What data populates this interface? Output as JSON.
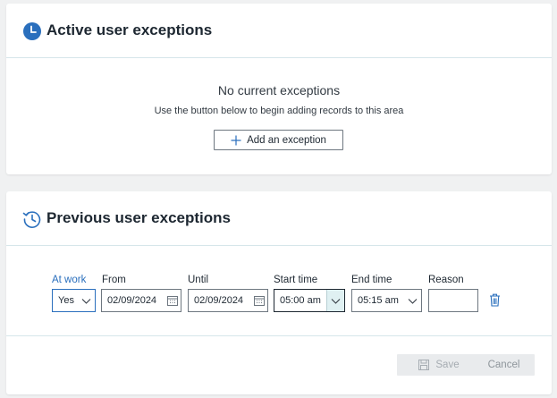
{
  "active": {
    "title": "Active user exceptions",
    "icon": "clock-icon",
    "empty_title": "No current exceptions",
    "empty_subtitle": "Use the button below to begin adding records to this area",
    "add_button_label": "Add an exception"
  },
  "previous": {
    "title": "Previous user exceptions",
    "icon": "history-icon",
    "columns": {
      "at_work": "At work",
      "from": "From",
      "until": "Until",
      "start_time": "Start time",
      "end_time": "End time",
      "reason": "Reason"
    },
    "row": {
      "at_work": "Yes",
      "from": "02/09/2024",
      "until": "02/09/2024",
      "start_time": "05:00 am",
      "end_time": "05:15 am",
      "reason": ""
    },
    "save_label": "Save",
    "cancel_label": "Cancel"
  },
  "colors": {
    "accent": "#2a6fbd",
    "divider": "#d6e6ea",
    "disabled_bg": "#e9ebed"
  }
}
